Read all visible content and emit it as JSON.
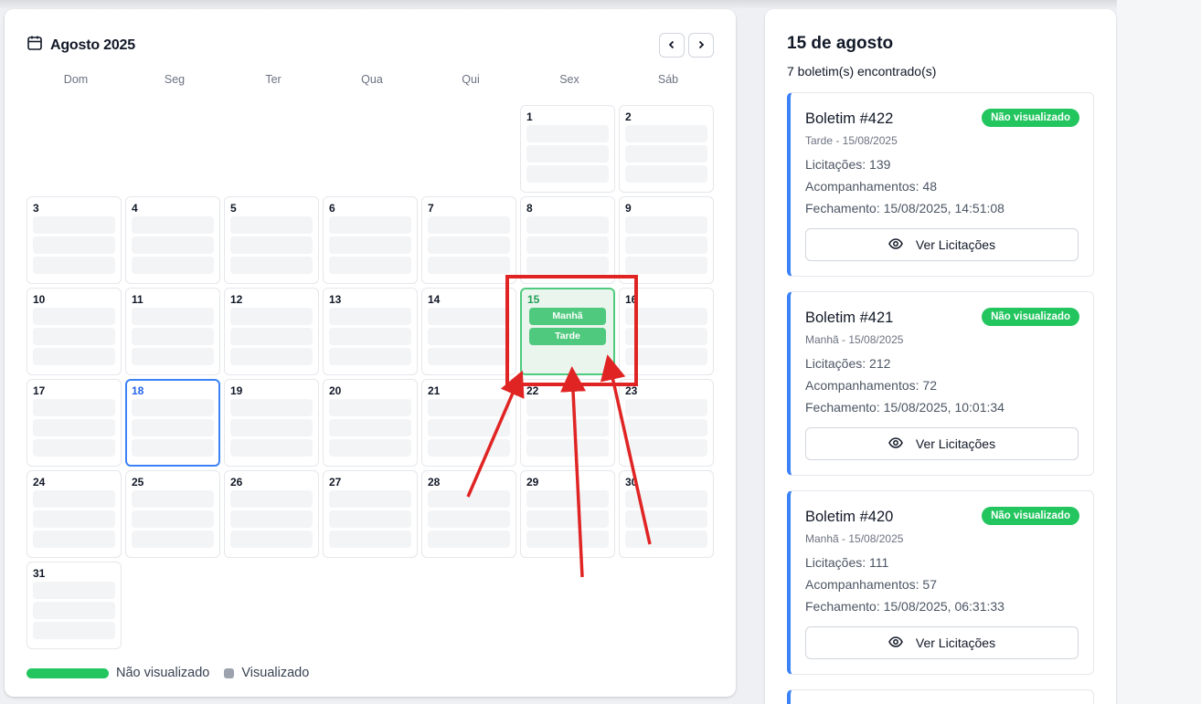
{
  "calendar": {
    "month_title": "Agosto 2025",
    "prev_icon": "chevron-left-icon",
    "next_icon": "chevron-right-icon",
    "weekdays": [
      "Dom",
      "Seg",
      "Ter",
      "Qua",
      "Qui",
      "Sex",
      "Sáb"
    ],
    "days": [
      "1",
      "2",
      "3",
      "4",
      "5",
      "6",
      "7",
      "8",
      "9",
      "10",
      "11",
      "12",
      "13",
      "14",
      "15",
      "16",
      "17",
      "18",
      "19",
      "20",
      "21",
      "22",
      "23",
      "24",
      "25",
      "26",
      "27",
      "28",
      "29",
      "30",
      "31"
    ],
    "selected_day": "15",
    "today": "18",
    "selected_pills": [
      "Manhã",
      "Tarde"
    ],
    "legend": {
      "unseen": "Não visualizado",
      "seen": "Visualizado"
    },
    "colors": {
      "unseen": "#22c55e",
      "seen": "#9ca3af",
      "today_border": "#3b82f6"
    }
  },
  "side": {
    "title": "15 de agosto",
    "subtitle": "7 boletim(s) encontrado(s)",
    "boletins": [
      {
        "title": "Boletim #422",
        "badge": "Não visualizado",
        "meta": "Tarde - 15/08/2025",
        "licitacoes": "Licitações: 139",
        "acompanhamentos": "Acompanhamentos: 48",
        "fechamento": "Fechamento: 15/08/2025, 14:51:08",
        "button": "Ver Licitações"
      },
      {
        "title": "Boletim #421",
        "badge": "Não visualizado",
        "meta": "Manhã - 15/08/2025",
        "licitacoes": "Licitações: 212",
        "acompanhamentos": "Acompanhamentos: 72",
        "fechamento": "Fechamento: 15/08/2025, 10:01:34",
        "button": "Ver Licitações"
      },
      {
        "title": "Boletim #420",
        "badge": "Não visualizado",
        "meta": "Manhã - 15/08/2025",
        "licitacoes": "Licitações: 111",
        "acompanhamentos": "Acompanhamentos: 57",
        "fechamento": "Fechamento: 15/08/2025, 06:31:33",
        "button": "Ver Licitações"
      }
    ]
  }
}
